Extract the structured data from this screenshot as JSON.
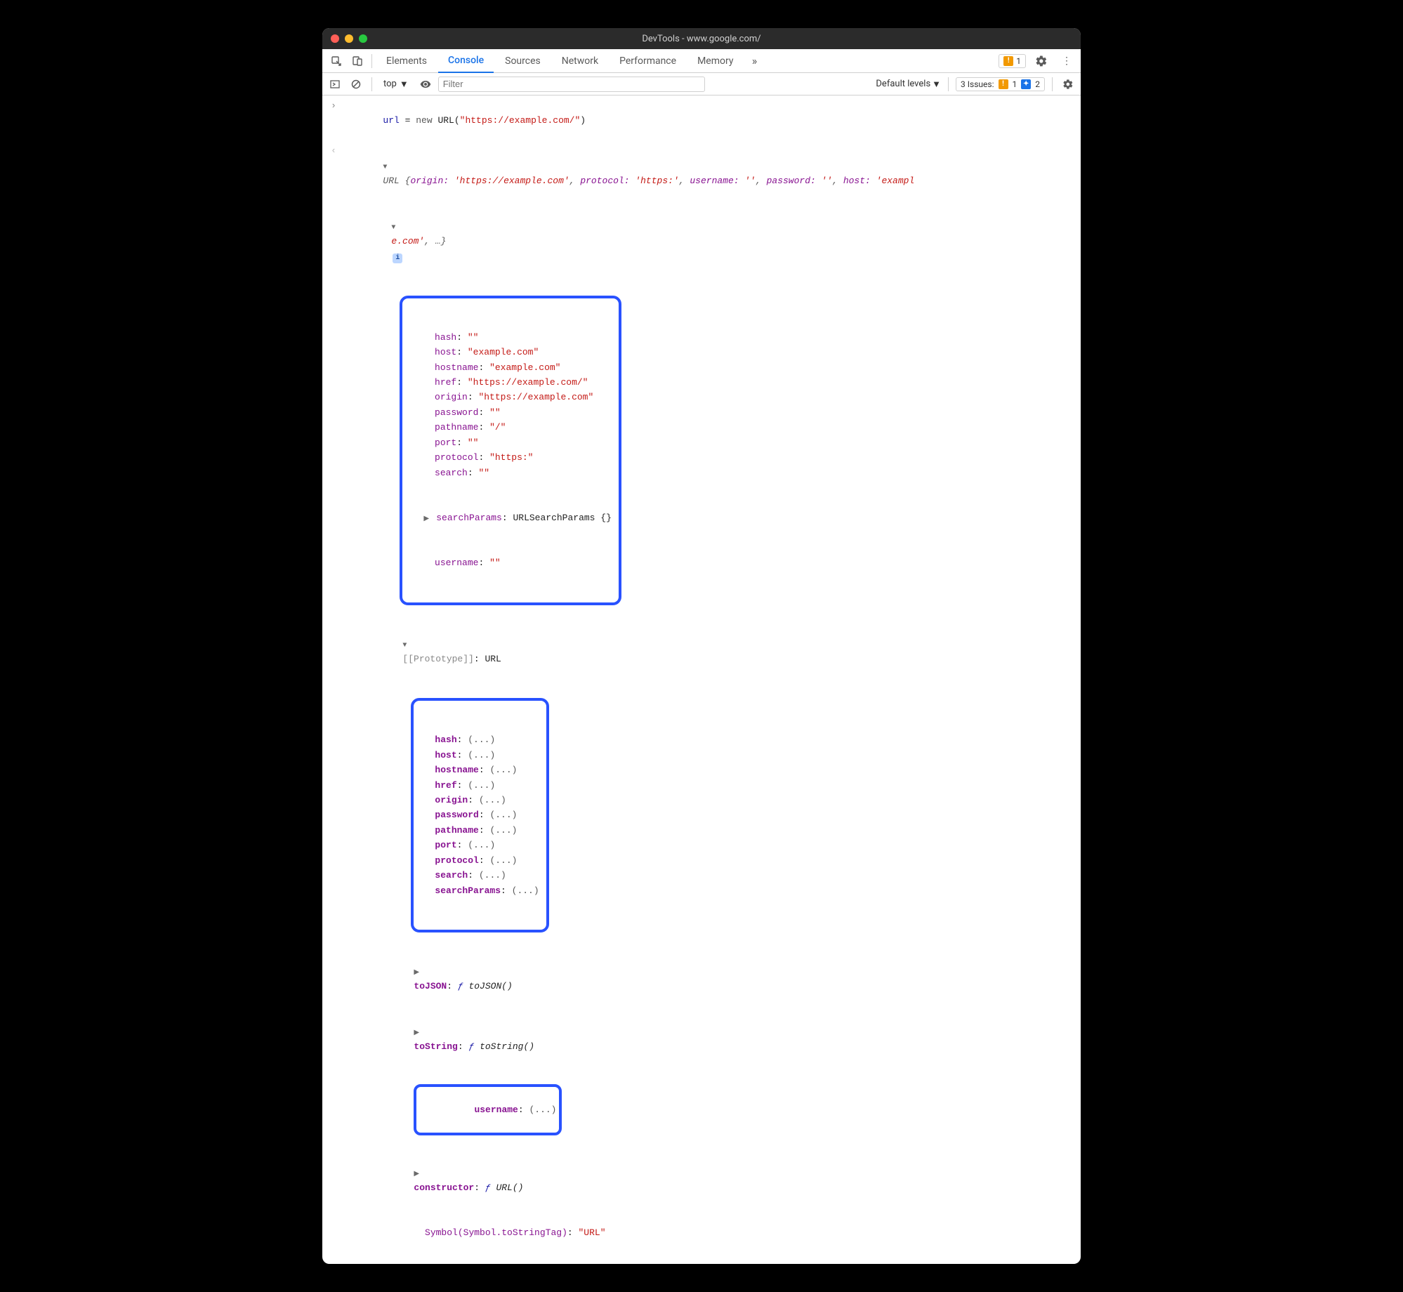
{
  "window": {
    "title": "DevTools - www.google.com/"
  },
  "tabs": {
    "items": [
      "Elements",
      "Console",
      "Sources",
      "Network",
      "Performance",
      "Memory"
    ],
    "active": "Console",
    "warning_count": "1"
  },
  "toolbar": {
    "context": "top",
    "filter_placeholder": "Filter",
    "levels": "Default levels",
    "issues_label": "3 Issues:",
    "issues_warn": "1",
    "issues_info": "2"
  },
  "console": {
    "input": {
      "var": "url",
      "eq": " = ",
      "new": "new",
      "ctor": " URL(",
      "arg": "\"https://example.com/\"",
      "close": ")"
    },
    "summary": {
      "class": "URL ",
      "brace_open": "{",
      "k_origin": "origin:",
      "v_origin": " 'https://example.com'",
      "k_protocol": "protocol:",
      "v_protocol": " 'https:'",
      "k_username": "username:",
      "v_username": " ''",
      "k_password": "password:",
      "v_password": " ''",
      "k_host": "host:",
      "v_host": " 'exampl",
      "line2": "e.com'",
      "ellipsis": ", …}",
      "sep": ", "
    },
    "props": [
      {
        "k": "hash",
        "v": "\"\""
      },
      {
        "k": "host",
        "v": "\"example.com\""
      },
      {
        "k": "hostname",
        "v": "\"example.com\""
      },
      {
        "k": "href",
        "v": "\"https://example.com/\""
      },
      {
        "k": "origin",
        "v": "\"https://example.com\""
      },
      {
        "k": "password",
        "v": "\"\""
      },
      {
        "k": "pathname",
        "v": "\"/\""
      },
      {
        "k": "port",
        "v": "\"\""
      },
      {
        "k": "protocol",
        "v": "\"https:\""
      },
      {
        "k": "search",
        "v": "\"\""
      }
    ],
    "searchParams": {
      "k": "searchParams",
      "v": "URLSearchParams {}"
    },
    "username_prop": {
      "k": "username",
      "v": "\"\""
    },
    "prototype_label": "[[Prototype]]",
    "prototype_value": "URL",
    "proto_getters": [
      "hash",
      "host",
      "hostname",
      "href",
      "origin",
      "password",
      "pathname",
      "port",
      "protocol",
      "search",
      "searchParams"
    ],
    "proto_getter_val": "(...)",
    "proto_fns": {
      "toJSON": {
        "name": "toJSON",
        "sig": "toJSON()"
      },
      "toString": {
        "name": "toString",
        "sig": "toString()"
      }
    },
    "proto_username": {
      "k": "username",
      "v": "(...)"
    },
    "proto_constructor": {
      "k": "constructor",
      "sig": "URL()"
    },
    "symbol": {
      "k": "Symbol(Symbol.toStringTag)",
      "v": "\"URL\""
    }
  }
}
